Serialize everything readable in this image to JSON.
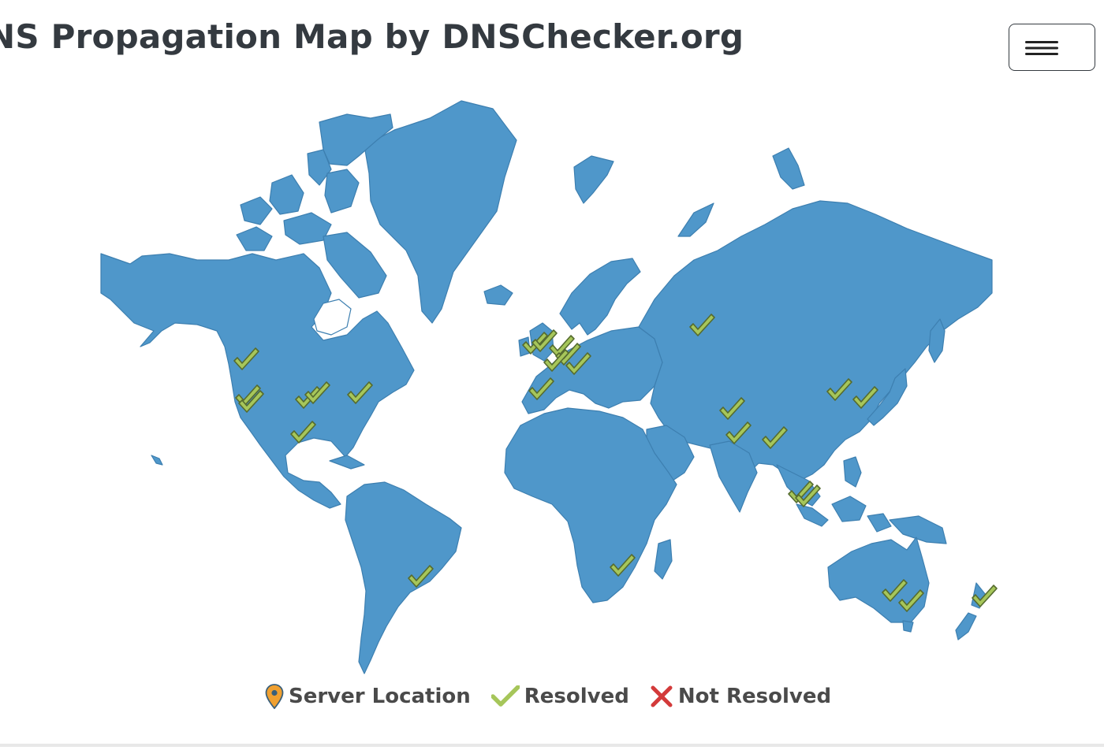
{
  "header": {
    "title": "NS Propagation Map by DNSChecker.org",
    "menu_icon": "hamburger-icon"
  },
  "map": {
    "land_color": "#4f97ca",
    "land_stroke": "#3d7fb0",
    "marker_icon": "checkmark-icon",
    "marker_color": "#a6c65a",
    "resolved_locations": [
      "Vancouver",
      "San Francisco",
      "Los Angeles",
      "Denver",
      "Kansas City",
      "Chicago",
      "New York",
      "Houston",
      "São Paulo",
      "Dublin",
      "London",
      "Amsterdam",
      "Frankfurt",
      "Paris",
      "Madrid",
      "Zurich",
      "Milan",
      "Moscow",
      "Johannesburg",
      "Islamabad",
      "New Delhi",
      "Dhaka",
      "Beijing",
      "Seoul",
      "Kuala Lumpur",
      "Singapore",
      "Melbourne",
      "Sydney",
      "Auckland"
    ]
  },
  "legend": {
    "server_location": {
      "label": "Server Location",
      "icon": "map-pin-icon",
      "color": "#f0a030"
    },
    "resolved": {
      "label": "Resolved",
      "icon": "checkmark-icon",
      "color": "#a6c65a"
    },
    "not_resolved": {
      "label": "Not Resolved",
      "icon": "cross-icon",
      "color": "#d33a3a"
    }
  }
}
